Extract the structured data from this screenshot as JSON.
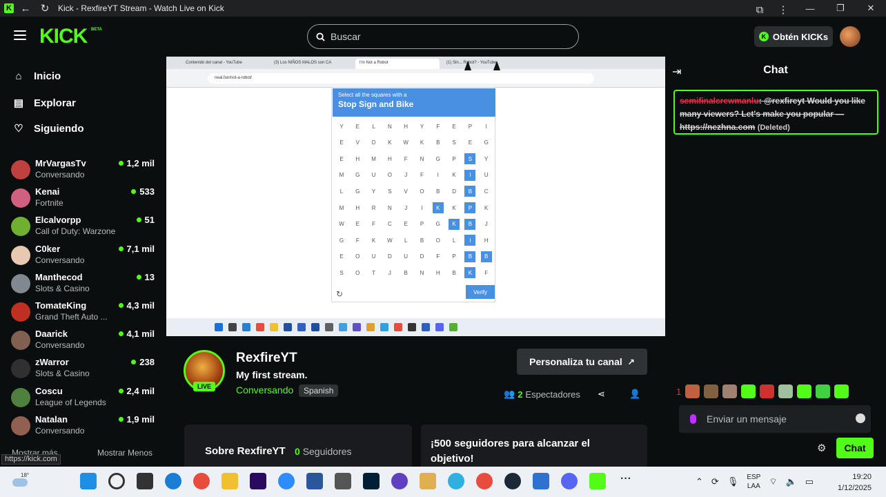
{
  "browser": {
    "tab_title": "Kick - RexfireYT Stream - Watch Live on Kick"
  },
  "header": {
    "logo": "KICK",
    "logo_badge": "BETA",
    "search_placeholder": "Buscar",
    "get_kicks_label": "Obtén KICKs"
  },
  "sidebar": {
    "nav": [
      {
        "label": "Inicio",
        "icon": "home-icon"
      },
      {
        "label": "Explorar",
        "icon": "explore-icon"
      },
      {
        "label": "Siguiendo",
        "icon": "heart-icon"
      }
    ],
    "channels": [
      {
        "name": "MrVargasTv",
        "category": "Conversando",
        "viewers": "1,2 mil",
        "color": "#c04040"
      },
      {
        "name": "Kenai",
        "category": "Fortnite",
        "viewers": "533",
        "color": "#d06080"
      },
      {
        "name": "Elcalvorpp",
        "category": "Call of Duty: Warzone",
        "viewers": "51",
        "color": "#70b030"
      },
      {
        "name": "C0ker",
        "category": "Conversando",
        "viewers": "7,1 mil",
        "color": "#e8c8b0"
      },
      {
        "name": "Manthecod",
        "category": "Slots & Casino",
        "viewers": "13",
        "color": "#808890"
      },
      {
        "name": "TomateKing",
        "category": "Grand Theft Auto ...",
        "viewers": "4,3 mil",
        "color": "#c03020"
      },
      {
        "name": "Daarick",
        "category": "Conversando",
        "viewers": "4,1 mil",
        "color": "#806050"
      },
      {
        "name": "zWarror",
        "category": "Slots & Casino",
        "viewers": "238",
        "color": "#303030"
      },
      {
        "name": "Coscu",
        "category": "League of Legends",
        "viewers": "2,4 mil",
        "color": "#508040"
      },
      {
        "name": "Natalan",
        "category": "Conversando",
        "viewers": "1,9 mil",
        "color": "#906050"
      }
    ],
    "show_more": "Mostrar más",
    "show_less": "Mostrar Menos",
    "url_tooltip": "https://kick.com"
  },
  "video": {
    "tabs": [
      "Contenido del canal - YouTube",
      "(3) Los NIÑOS MALOS son CA",
      "I'm Not a Robot",
      "(1) Sin... Robot? - YouTube"
    ],
    "url": "neal.fun/not-a-robot/",
    "captcha": {
      "instruction": "Select all the squares with a",
      "target": "Stop Sign and Bike",
      "verify_label": "Verify",
      "rows": [
        "YELNHYFEPI",
        "EVDKWKBSEG",
        "EHMHFNGPSY",
        "MGUOJFIKIU",
        "LGYSVOBDBC",
        "MHRNJIKKPK",
        "WEFCEPGKBJ",
        "GFKWLBOLIH",
        "EOUDUDFPBB",
        "SOTJBNHBKF"
      ],
      "selected": [
        [
          2,
          8
        ],
        [
          3,
          8
        ],
        [
          4,
          8
        ],
        [
          5,
          6
        ],
        [
          5,
          8
        ],
        [
          6,
          7
        ],
        [
          6,
          8
        ],
        [
          7,
          8
        ],
        [
          8,
          8
        ],
        [
          8,
          9
        ],
        [
          9,
          8
        ]
      ]
    }
  },
  "stream": {
    "live_badge": "LIVE",
    "streamer": "RexfireYT",
    "title": "My first stream.",
    "category": "Conversando",
    "language": "Spanish",
    "customize_label": "Personaliza tu canal",
    "viewers_count": "2",
    "viewers_label": "Espectadores",
    "about_label": "Sobre RexfireYT",
    "followers_count": "0",
    "followers_label": "Seguidores",
    "goal_text": "¡500 seguidores para alcanzar el objetivo!"
  },
  "chat": {
    "title": "Chat",
    "message": {
      "user": "semifinalcrewmanlu",
      "text": "@rexfireyt Would you like many viewers? Let's make you popular — https://nezhna.com",
      "deleted": "(Deleted)"
    },
    "emote_count": "1",
    "input_placeholder": "Enviar un mensaje",
    "send_label": "Chat"
  },
  "taskbar": {
    "temperature": "18°",
    "lang_top": "ESP",
    "lang_bottom": "LAA",
    "time": "19:20",
    "date": "1/12/2025"
  },
  "colors": {
    "accent": "#53fc18",
    "background": "#0b0e0f",
    "captcha_blue": "#4a90e2"
  }
}
